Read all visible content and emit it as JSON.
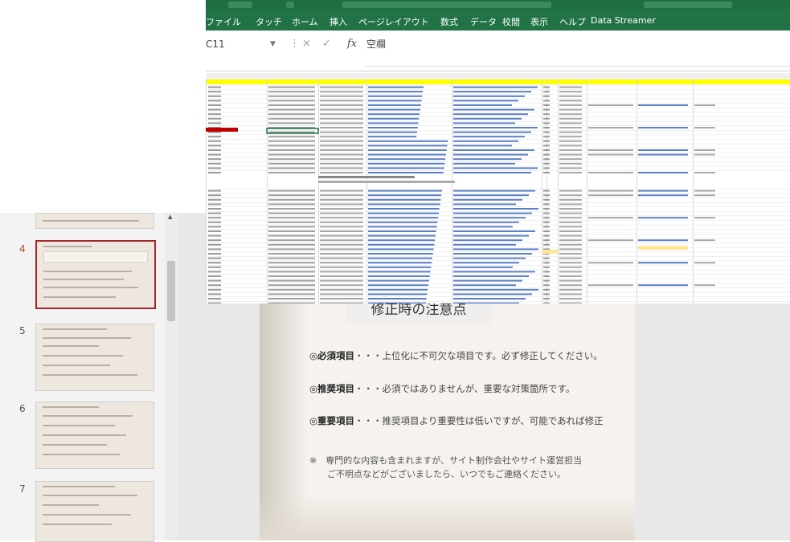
{
  "excel": {
    "tabs": [
      "ファイル",
      "タッチ",
      "ホーム",
      "挿入",
      "ページレイアウト",
      "数式",
      "データ",
      "校閲",
      "表示",
      "ヘルプ",
      "Data Streamer"
    ],
    "name_box": "C11",
    "formula_value": "空欄",
    "cell_cancel": "×",
    "cell_enter": "✓",
    "fx": "fx"
  },
  "ppt": {
    "slide_numbers": [
      "4",
      "5",
      "6",
      "7"
    ],
    "active_slide": "4",
    "slide": {
      "title": "修正時の注意点",
      "items": [
        {
          "term": "◎必須項目",
          "text": "・・・上位化に不可欠な項目です。必ず修正してください。"
        },
        {
          "term": "◎推奨項目",
          "text": "・・・必須ではありませんが、重要な対策箇所です。"
        },
        {
          "term": "◎重要項目",
          "text": "・・・推奨項目より重要性は低いですが、可能であれば修正"
        }
      ],
      "note_line1": "※　専門的な内容も含まれますが、サイト制作会社やサイト運営担当",
      "note_line2": "　　ご不明点などがございましたら、いつでもご連絡ください。"
    }
  },
  "colors": {
    "excel_green": "#217346",
    "header_yellow": "#ffff00",
    "link_blue": "#2b5fb8",
    "ppt_active_border": "#a4262c"
  }
}
